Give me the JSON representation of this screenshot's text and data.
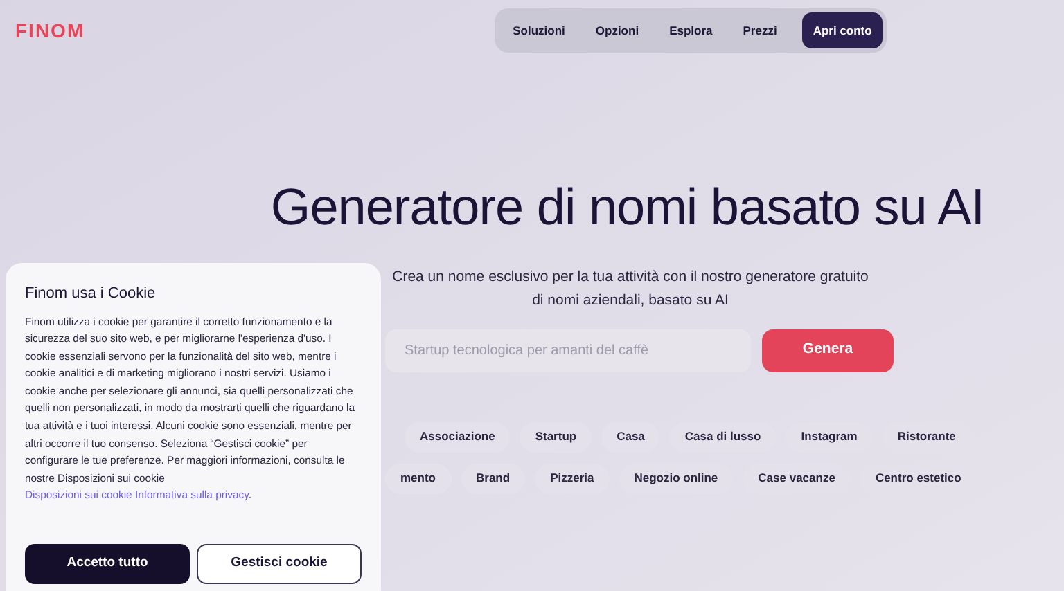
{
  "logo": "FINOM",
  "nav": {
    "items": [
      {
        "label": "Soluzioni"
      },
      {
        "label": "Opzioni"
      },
      {
        "label": "Esplora"
      },
      {
        "label": "Prezzi"
      }
    ],
    "cta": "Apri conto"
  },
  "hero": {
    "title": "Generatore di nomi basato su AI",
    "subtitle": "Crea un nome esclusivo per la tua attività con il nostro generatore gratuito di nomi aziendali, basato su AI"
  },
  "search": {
    "placeholder": "Startup tecnologica per amanti del caffè",
    "button": "Genera"
  },
  "tags_row_1": [
    "Associazione",
    "Startup",
    "Casa",
    "Casa di lusso",
    "Instagram",
    "Ristorante"
  ],
  "tags_row_2": [
    "mento",
    "Brand",
    "Pizzeria",
    "Negozio online",
    "Case vacanze",
    "Centro estetico"
  ],
  "cookie_banner": {
    "title": "Finom usa i Cookie",
    "body": "Finom utilizza i cookie per garantire il corretto funzionamento e la sicurezza del suo sito web, e per migliorarne l'esperienza d'uso. I cookie essenziali servono per la funzionalità del sito web, mentre i cookie analitici e di marketing migliorano i nostri servizi. Usiamo i cookie anche per selezionare gli annunci, sia quelli personalizzati che quelli non personalizzati, in modo da mostrarti quelli che riguardano la tua attività e i tuoi interessi. Alcuni cookie sono essenziali, mentre per altri occorre il tuo consenso. Seleziona “Gestisci cookie” per configurare le tue preferenze. Per maggiori informazioni, consulta le nostre Disposizioni sui cookie",
    "links": [
      "Disposizioni sui cookie",
      "Informativa sulla privacy"
    ],
    "links_end": ".",
    "accept": "Accetto tutto",
    "manage": "Gestisci cookie"
  }
}
